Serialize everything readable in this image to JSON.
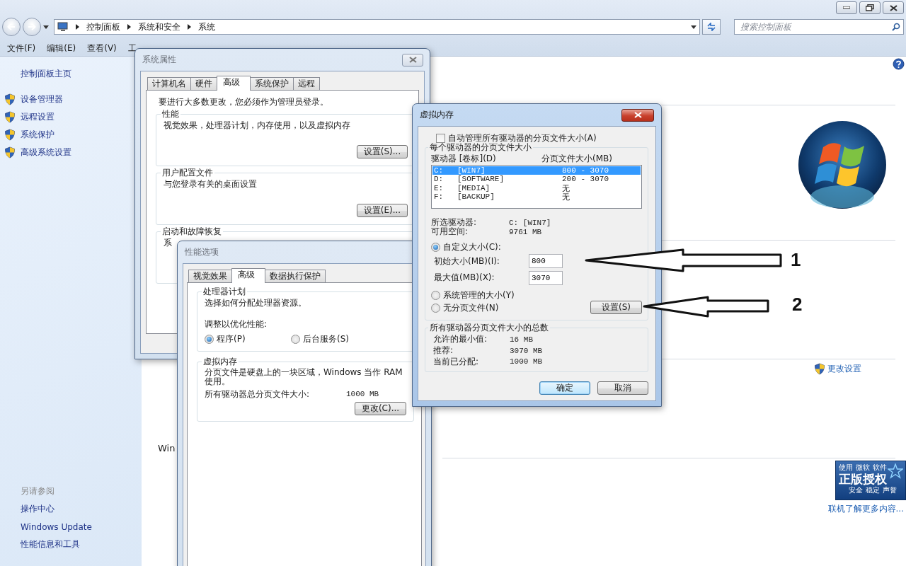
{
  "explorer": {
    "breadcrumb": [
      "控制面板",
      "系统和安全",
      "系统"
    ],
    "search": {
      "placeholder": "搜索控制面板"
    },
    "menu": [
      "文件(F)",
      "编辑(E)",
      "查看(V)",
      "工"
    ],
    "sidebar": {
      "home": "控制面板主页",
      "links": [
        "设备管理器",
        "远程设置",
        "系统保护",
        "高级系统设置"
      ],
      "see_also_title": "另请参阅",
      "see_also": [
        "操作中心",
        "Windows Update",
        "性能信息和工具"
      ]
    },
    "content_fragments": [
      {
        "text": "Win",
        "kind": "heading"
      }
    ],
    "change_settings": "更改设置",
    "genuine_badge": {
      "top": [
        "使用",
        "微软",
        "软件"
      ],
      "title": "正版授权",
      "bottom": [
        "安全",
        "稳定",
        "声誉"
      ]
    },
    "learn_more": "联机了解更多内容..."
  },
  "system_properties": {
    "title": "系统属性",
    "tabs": [
      {
        "label": "计算机名",
        "selected": false
      },
      {
        "label": "硬件",
        "selected": false
      },
      {
        "label": "高级",
        "selected": true
      },
      {
        "label": "系统保护",
        "selected": false
      },
      {
        "label": "远程",
        "selected": false
      }
    ],
    "admin_note": "要进行大多数更改，您必须作为管理员登录。",
    "groups": [
      {
        "title": "性能",
        "text": "视觉效果，处理器计划，内存使用，以及虚拟内存",
        "button": "设置(S)..."
      },
      {
        "title": "用户配置文件",
        "text": "与您登录有关的桌面设置",
        "button": "设置(E)..."
      },
      {
        "title": "启动和故障恢复",
        "text": "系"
      }
    ]
  },
  "performance_options": {
    "title": "性能选项",
    "tabs": [
      {
        "label": "视觉效果",
        "selected": false
      },
      {
        "label": "高级",
        "selected": true
      },
      {
        "label": "数据执行保护",
        "selected": false
      }
    ],
    "processor": {
      "title": "处理器计划",
      "text": "选择如何分配处理器资源。",
      "adjust_label": "调整以优化性能:",
      "options": [
        {
          "label": "程序(P)",
          "selected": true
        },
        {
          "label": "后台服务(S)",
          "selected": false
        }
      ]
    },
    "virtual_memory": {
      "title": "虚拟内存",
      "text": "分页文件是硬盘上的一块区域，Windows 当作 RAM 使用。",
      "total_label": "所有驱动器总分页文件大小:",
      "total_value": "1000 MB",
      "button": "更改(C)..."
    }
  },
  "virtual_memory": {
    "title": "虚拟内存",
    "auto_manage": {
      "label": "自动管理所有驱动器的分页文件大小(A)",
      "checked": false
    },
    "group_title": "每个驱动器的分页文件大小",
    "columns": [
      "驱动器 [卷标](D)",
      "分页文件大小(MB)"
    ],
    "drives": [
      {
        "drive": "C:",
        "label": "[WIN7]",
        "size": "800 - 3070",
        "selected": true
      },
      {
        "drive": "D:",
        "label": "[SOFTWARE]",
        "size": "200 - 3070",
        "selected": false
      },
      {
        "drive": "E:",
        "label": "[MEDIA]",
        "size": "无",
        "selected": false
      },
      {
        "drive": "F:",
        "label": "[BACKUP]",
        "size": "无",
        "selected": false
      }
    ],
    "selected_drive": {
      "label": "所选驱动器:",
      "value": "C:  [WIN7]"
    },
    "free_space": {
      "label": "可用空间:",
      "value": "9761 MB"
    },
    "size_options": [
      {
        "label": "自定义大小(C):",
        "selected": true
      },
      {
        "label": "系统管理的大小(Y)",
        "selected": false
      },
      {
        "label": "无分页文件(N)",
        "selected": false
      }
    ],
    "initial_size": {
      "label": "初始大小(MB)(I):",
      "value": "800"
    },
    "max_size": {
      "label": "最大值(MB)(X):",
      "value": "3070"
    },
    "set_button": "设置(S)",
    "totals": {
      "title": "所有驱动器分页文件大小的总数",
      "rows": [
        {
          "label": "允许的最小值:",
          "value": "16 MB"
        },
        {
          "label": "推荐:",
          "value": "3070 MB"
        },
        {
          "label": "当前已分配:",
          "value": "1000 MB"
        }
      ]
    },
    "buttons": [
      "确定",
      "取消"
    ]
  },
  "annotations": [
    "1",
    "2"
  ]
}
